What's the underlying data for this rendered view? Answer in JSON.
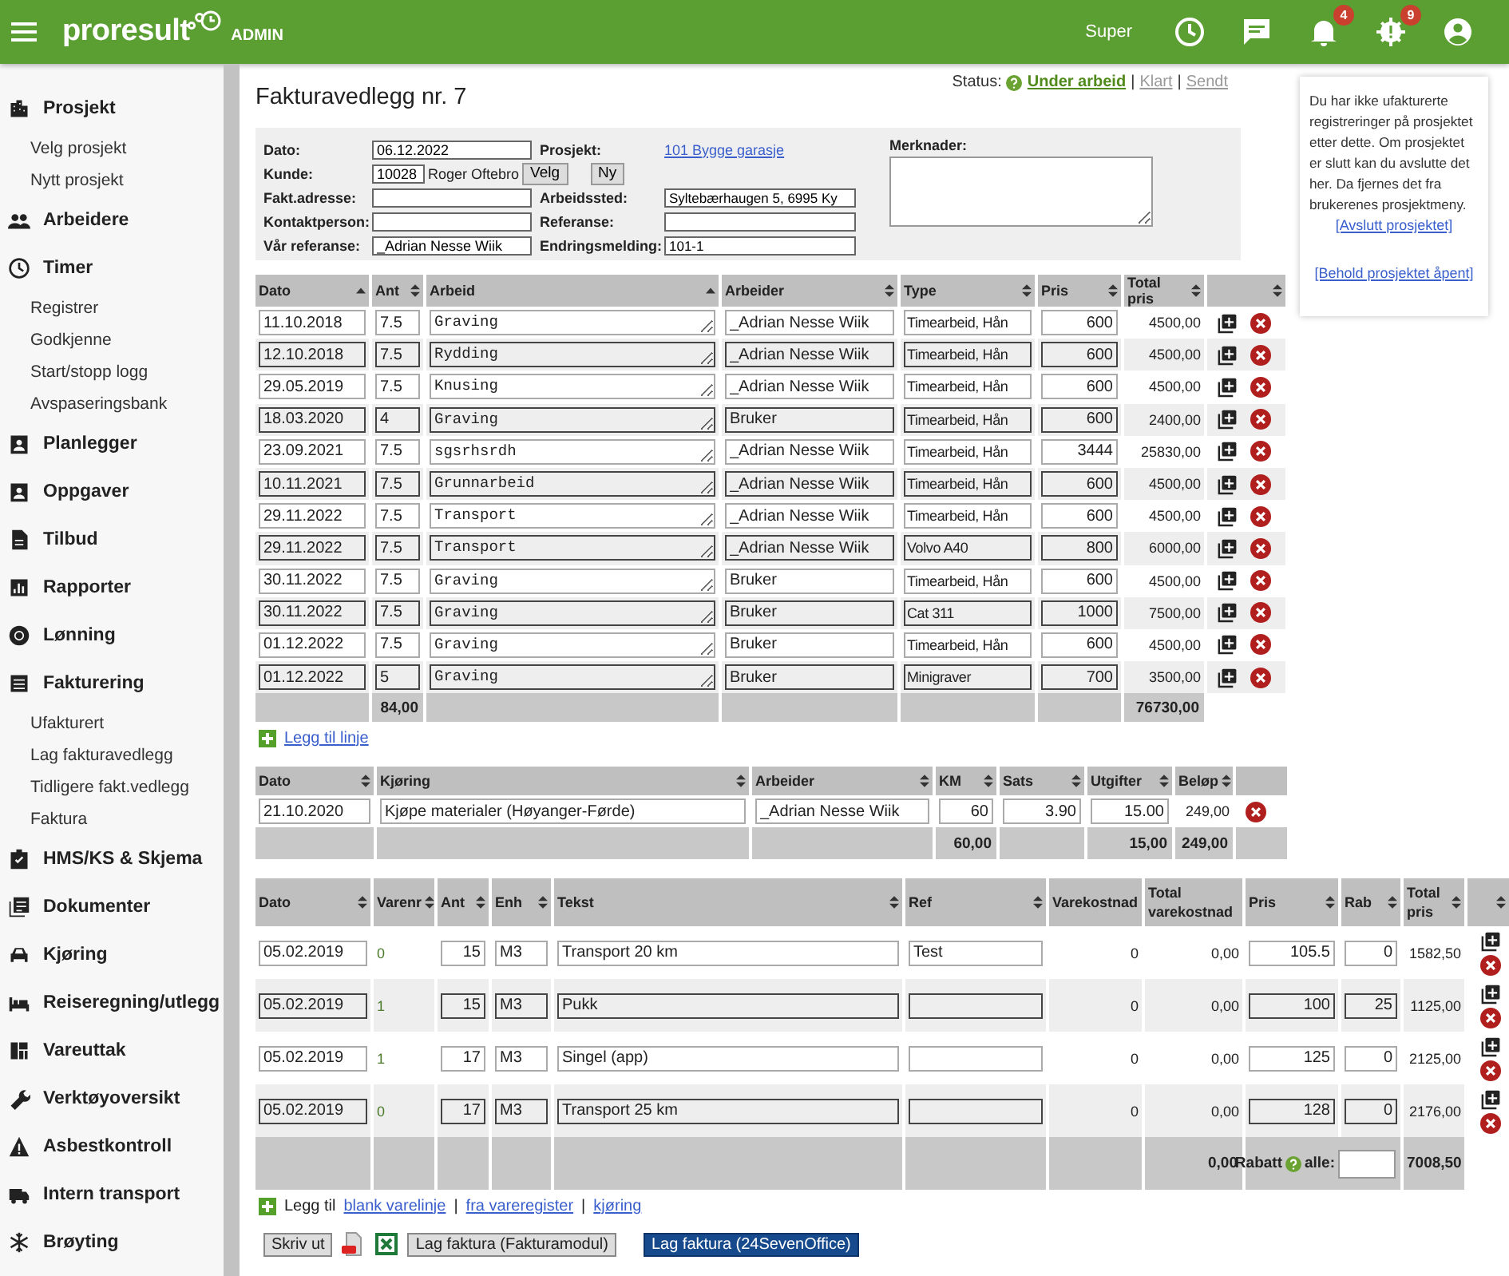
{
  "header": {
    "logo": "proresult",
    "badge": "ADMIN",
    "user": "Super",
    "counters": [
      {
        "kind": "bell",
        "count": "4"
      },
      {
        "kind": "alert",
        "count": "9"
      }
    ]
  },
  "sidebar": [
    {
      "label": "Prosjekt",
      "kind": "building",
      "items": [
        "Velg prosjekt",
        "Nytt prosjekt"
      ]
    },
    {
      "label": "Arbeidere",
      "kind": "people"
    },
    {
      "label": "Timer",
      "kind": "clock",
      "items": [
        "Registrer",
        "Godkjenne",
        "Start/stopp logg",
        "Avspaseringsbank"
      ]
    },
    {
      "label": "Planlegger",
      "kind": "badge"
    },
    {
      "label": "Oppgaver",
      "kind": "badge"
    },
    {
      "label": "Tilbud",
      "kind": "document"
    },
    {
      "label": "Rapporter",
      "kind": "chart"
    },
    {
      "label": "Lønning",
      "kind": "coin"
    },
    {
      "label": "Fakturering",
      "kind": "list",
      "items": [
        "Ufakturert",
        "Lag fakturavedlegg",
        "Tidligere fakt.vedlegg",
        "Faktura"
      ]
    },
    {
      "label": "HMS/KS & Skjema",
      "kind": "clipboard"
    },
    {
      "label": "Dokumenter",
      "kind": "documents"
    },
    {
      "label": "Kjøring",
      "kind": "car"
    },
    {
      "label": "Reiseregning/utlegg",
      "kind": "bed"
    },
    {
      "label": "Vareuttak",
      "kind": "grid"
    },
    {
      "label": "Verktøyoversikt",
      "kind": "wrench"
    },
    {
      "label": "Asbestkontroll",
      "kind": "warning"
    },
    {
      "label": "Intern transport",
      "kind": "truck"
    },
    {
      "label": "Brøyting",
      "kind": "snowflake"
    }
  ],
  "title": "Fakturavedlegg nr. 7",
  "status": {
    "label": "Status:",
    "separator": "|",
    "options": [
      {
        "label": "Under arbeid",
        "selected": true
      },
      {
        "label": "Klart",
        "selected": false
      },
      {
        "label": "Sendt",
        "selected": false
      }
    ]
  },
  "form": {
    "left": [
      {
        "label": "Dato:",
        "kind": "input",
        "value": "06.12.2022"
      },
      {
        "label": "Kunde:",
        "kind": "customer",
        "value": "10028",
        "name": "Roger Oftebro",
        "buttons": [
          "Velg",
          "Ny"
        ]
      },
      {
        "label": "Fakt.adresse:",
        "kind": "input"
      },
      {
        "label": "Kontaktperson:",
        "kind": "input"
      },
      {
        "label": "Vår referanse:",
        "kind": "input",
        "value": "_Adrian Nesse Wiik"
      }
    ],
    "middle": [
      {
        "label": "Prosjekt:",
        "kind": "link",
        "value": "101 Bygge garasje"
      },
      {
        "label": "Arbeidssted:",
        "kind": "input",
        "value": "Syltebærhaugen 5, 6995 Ky"
      },
      {
        "label": "Referanse:",
        "kind": "input"
      },
      {
        "label": "Endringsmelding:",
        "kind": "input",
        "value": "101-1"
      }
    ],
    "notes": {
      "label": "Merknader:"
    }
  },
  "work_table": {
    "columns": [
      {
        "label": "Dato",
        "kind": "sortable",
        "sorted": true
      },
      {
        "label": "Ant",
        "kind": "sortable",
        "sorted": false
      },
      {
        "label": "Arbeid",
        "kind": "sortable",
        "sorted": true
      },
      {
        "label": "Arbeider",
        "kind": "sortable",
        "sorted": false
      },
      {
        "label": "Type",
        "kind": "sortable",
        "sorted": false
      },
      {
        "label": "Pris",
        "kind": "sortable",
        "sorted": false
      },
      {
        "label": "Total pris",
        "kind": "sortable",
        "sorted": false
      },
      {
        "kind": "sortable",
        "sorted": false
      }
    ],
    "rows": [
      {
        "date": "11.10.2018",
        "qty": "7.5",
        "work": "Graving",
        "worker": "_Adrian Nesse Wiik",
        "type": "Timearbeid, Hån",
        "price": "600",
        "total": "4500,00"
      },
      {
        "date": "12.10.2018",
        "qty": "7.5",
        "work": "Rydding",
        "worker": "_Adrian Nesse Wiik",
        "type": "Timearbeid, Hån",
        "price": "600",
        "total": "4500,00"
      },
      {
        "date": "29.05.2019",
        "qty": "7.5",
        "work": "Knusing",
        "worker": "_Adrian Nesse Wiik",
        "type": "Timearbeid, Hån",
        "price": "600",
        "total": "4500,00"
      },
      {
        "date": "18.03.2020",
        "qty": "4",
        "work": "Graving",
        "worker": "Bruker",
        "type": "Timearbeid, Hån",
        "price": "600",
        "total": "2400,00"
      },
      {
        "date": "23.09.2021",
        "qty": "7.5",
        "work": "sgsrhsrdh",
        "worker": "_Adrian Nesse Wiik",
        "type": "Timearbeid, Hån",
        "price": "3444",
        "total": "25830,00"
      },
      {
        "date": "10.11.2021",
        "qty": "7.5",
        "work": "Grunnarbeid",
        "worker": "_Adrian Nesse Wiik",
        "type": "Timearbeid, Hån",
        "price": "600",
        "total": "4500,00"
      },
      {
        "date": "29.11.2022",
        "qty": "7.5",
        "work": "Transport",
        "worker": "_Adrian Nesse Wiik",
        "type": "Timearbeid, Hån",
        "price": "600",
        "total": "4500,00"
      },
      {
        "date": "29.11.2022",
        "qty": "7.5",
        "work": "Transport",
        "worker": "_Adrian Nesse Wiik",
        "type": "Volvo A40",
        "price": "800",
        "total": "6000,00"
      },
      {
        "date": "30.11.2022",
        "qty": "7.5",
        "work": "Graving",
        "worker": "Bruker",
        "type": "Timearbeid, Hån",
        "price": "600",
        "total": "4500,00"
      },
      {
        "date": "30.11.2022",
        "qty": "7.5",
        "work": "Graving",
        "worker": "Bruker",
        "type": "Cat 311",
        "price": "1000",
        "total": "7500,00"
      },
      {
        "date": "01.12.2022",
        "qty": "7.5",
        "work": "Graving",
        "worker": "Bruker",
        "type": "Timearbeid, Hån",
        "price": "600",
        "total": "4500,00"
      },
      {
        "date": "01.12.2022",
        "qty": "5",
        "work": "Graving",
        "worker": "Bruker",
        "type": "Minigraver",
        "price": "700",
        "total": "3500,00"
      }
    ],
    "totals": {
      "qty": "84,00",
      "total": "76730,00"
    },
    "add_link": "Legg til linje"
  },
  "driving_table": {
    "columns": [
      {
        "label": "Dato",
        "kind": "sortable",
        "sorted": false
      },
      {
        "label": "Kjøring",
        "kind": "sortable",
        "sorted": false
      },
      {
        "label": "Arbeider",
        "kind": "sortable",
        "sorted": false
      },
      {
        "label": "KM",
        "kind": "sortable",
        "sorted": false
      },
      {
        "label": "Sats",
        "kind": "sortable",
        "sorted": false
      },
      {
        "label": "Utgifter",
        "kind": "sortable",
        "sorted": false
      },
      {
        "label": "Beløp",
        "kind": "sortable",
        "sorted": false
      },
      {
        "kind": "plain"
      }
    ],
    "rows": [
      {
        "date": "21.10.2020",
        "trip": "Kjøpe materialer (Høyanger-Førde)",
        "worker": "_Adrian Nesse Wiik",
        "km": "60",
        "rate": "3.90",
        "expenses": "15.00",
        "amount": "249,00"
      }
    ],
    "totals": {
      "km": "60,00",
      "expenses": "15,00",
      "amount": "249,00"
    }
  },
  "items_table": {
    "columns": [
      {
        "label": "Dato",
        "kind": "sortable",
        "sorted": false
      },
      {
        "label": "Varenr",
        "kind": "sortable",
        "sorted": false
      },
      {
        "label": "Ant",
        "kind": "sortable",
        "sorted": false
      },
      {
        "label": "Enh",
        "kind": "sortable",
        "sorted": false
      },
      {
        "label": "Tekst",
        "kind": "sortable",
        "sorted": false
      },
      {
        "label": "Ref",
        "kind": "sortable",
        "sorted": false
      },
      {
        "label": "Varekostnad",
        "kind": "plain"
      },
      {
        "label": "Total varekostnad",
        "kind": "plain"
      },
      {
        "label": "Pris",
        "kind": "sortable",
        "sorted": false
      },
      {
        "label": "Rab",
        "kind": "sortable",
        "sorted": false
      },
      {
        "label": "Total pris",
        "kind": "sortable",
        "sorted": false
      },
      {
        "kind": "sortable",
        "sorted": false
      }
    ],
    "rows": [
      {
        "date": "05.02.2019",
        "item_no": "0",
        "qty": "15",
        "unit": "M3",
        "text": "Transport 20 km",
        "ref": "Test",
        "cost": "0",
        "total_cost": "0,00",
        "price": "105.5",
        "discount": "0",
        "total": "1582,50"
      },
      {
        "date": "05.02.2019",
        "item_no": "1",
        "qty": "15",
        "unit": "M3",
        "text": "Pukk",
        "cost": "0",
        "total_cost": "0,00",
        "price": "100",
        "discount": "25",
        "total": "1125,00"
      },
      {
        "date": "05.02.2019",
        "item_no": "1",
        "qty": "17",
        "unit": "M3",
        "text": "Singel (app)",
        "cost": "0",
        "total_cost": "0,00",
        "price": "125",
        "discount": "0",
        "total": "2125,00"
      },
      {
        "date": "05.02.2019",
        "item_no": "0",
        "qty": "17",
        "unit": "M3",
        "text": "Transport 25 km",
        "cost": "0",
        "total_cost": "0,00",
        "price": "128",
        "discount": "0",
        "total": "2176,00"
      }
    ],
    "totals": {
      "total_cost": "0,00",
      "discount_label": "Rabatt",
      "discount_suffix": "alle:",
      "total": "7008,50"
    }
  },
  "add_row": {
    "label": "Legg til",
    "separator": "|",
    "links": [
      "blank varelinje",
      "fra vareregister",
      "kjøring"
    ]
  },
  "buttons": [
    {
      "label": "Skriv ut",
      "kind": "default"
    },
    {
      "kind": "pdf"
    },
    {
      "kind": "excel"
    },
    {
      "label": "Lag faktura (Fakturamodul)",
      "kind": "default"
    },
    {
      "label": "Lag faktura (24SevenOffice)",
      "kind": "primary"
    }
  ],
  "side_panel": {
    "message": "Du har ikke ufakturerte registreringer på prosjektet etter dette. Om prosjektet er slutt kan du avslutte det her. Da fjernes det fra brukerenes prosjektmeny.",
    "links": [
      "[Avslutt prosjektet]",
      "[Behold prosjektet åpent]"
    ]
  }
}
